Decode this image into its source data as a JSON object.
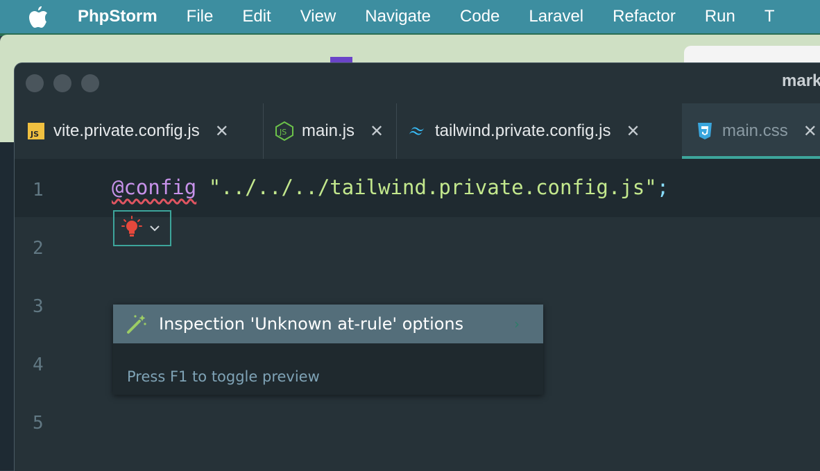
{
  "menubar": {
    "app_name": "PhpStorm",
    "items": [
      "File",
      "Edit",
      "View",
      "Navigate",
      "Code",
      "Laravel",
      "Refactor",
      "Run",
      "T"
    ]
  },
  "window": {
    "title": "mark"
  },
  "tabs": [
    {
      "label": "vite.private.config.js",
      "icon": "js-file-icon",
      "active": false
    },
    {
      "label": "main.js",
      "icon": "nodejs-icon",
      "active": false
    },
    {
      "label": "tailwind.private.config.js",
      "icon": "tailwind-icon",
      "active": false
    },
    {
      "label": "main.css",
      "icon": "css-file-icon",
      "active": true
    }
  ],
  "editor": {
    "line_numbers": [
      "1",
      "2",
      "3",
      "4",
      "5"
    ],
    "line1": {
      "at_rule": "@config",
      "string": "\"../../../tailwind.private.config.js\"",
      "semicolon": ";"
    }
  },
  "intention_popup": {
    "item_label": "Inspection 'Unknown at-rule' options",
    "hint": "Press F1 to toggle preview"
  },
  "colors": {
    "menubar_bg": "#3d8ea0",
    "editor_bg": "#263238",
    "accent": "#3da59b",
    "popup_selected": "#546e7a"
  }
}
